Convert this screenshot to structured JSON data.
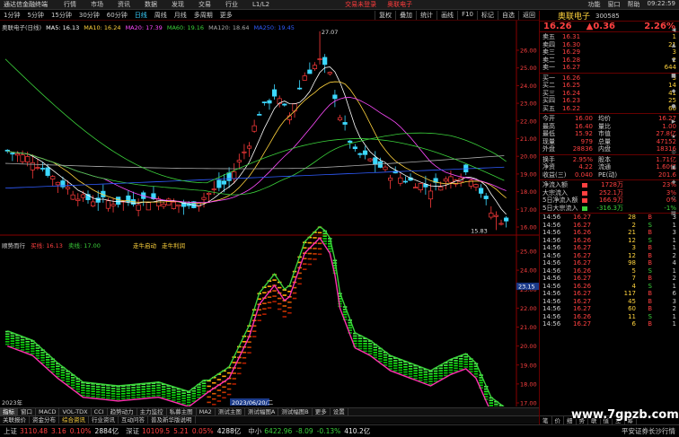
{
  "menu": {
    "logo": "通达信金融终端",
    "items": [
      "行情",
      "市场",
      "资讯",
      "数据",
      "发现",
      "交易",
      "行业",
      "L1/L2"
    ],
    "center": [
      "交易未登录",
      "奥联电子"
    ],
    "right": [
      "功能",
      "窗口",
      "帮助",
      "09:22:59"
    ]
  },
  "toolbar": {
    "periods": [
      "1分钟",
      "5分钟",
      "15分钟",
      "30分钟",
      "60分钟",
      "日线",
      "周线",
      "月线",
      "多周期",
      "更多"
    ],
    "active_index": 5,
    "right": [
      "复权",
      "叠加",
      "统计",
      "画线",
      "F10",
      "标记",
      "自选",
      "返回"
    ]
  },
  "indicator_header": {
    "title": "奥联电子(日线)",
    "ma": [
      {
        "label": "MA5: 16.13",
        "color": "#ffffff"
      },
      {
        "label": "MA10: 16.24",
        "color": "#ffd33d"
      },
      {
        "label": "MA20: 17.39",
        "color": "#ff4bff"
      },
      {
        "label": "MA60: 19.16",
        "color": "#3bd13b"
      },
      {
        "label": "MA120: 18.64",
        "color": "#aaaaaa"
      },
      {
        "label": "MA250: 19.45",
        "color": "#2f5cff"
      }
    ]
  },
  "sub_header": {
    "name": "顺势而行",
    "items": [
      {
        "label": "买线: 16.13",
        "color": "#ff4040"
      },
      {
        "label": "卖线: 17.00",
        "color": "#3bd13b"
      },
      {
        "label": "走牛启动",
        "color": "#ffd33d"
      },
      {
        "label": "走牛利润",
        "color": "#ffd33d"
      }
    ]
  },
  "chart_data": {
    "type": "candlestick",
    "main_axis": [
      "26.00",
      "25.00",
      "24.00",
      "23.00",
      "22.00",
      "21.00",
      "20.00",
      "19.00",
      "18.00",
      "17.00",
      "16.00"
    ],
    "sub_axis": [
      "25.00",
      "24.00",
      "23.00",
      "22.00",
      "21.00",
      "20.00",
      "19.00",
      "18.00",
      "17.00"
    ],
    "high_label": "27.07",
    "low_label": "15.83",
    "sub_price_tag": "23.15",
    "date_tags": [
      "2023年",
      "2023/06/20/二"
    ]
  },
  "tabs1": [
    "指标",
    "窗口",
    "MACD",
    "VOL-TDX",
    "CCI",
    "趋势动力",
    "主力监控",
    "私募主图",
    "MA2",
    "测试主图",
    "测试幅图A",
    "测试幅图B",
    "更多",
    "设置"
  ],
  "tabs1_active": 0,
  "tabs2": [
    "关联报价",
    "资金分布",
    "综合资讯",
    "行业资讯",
    "互动问答",
    "普及新华版说明"
  ],
  "tabs2_active": 2,
  "status": {
    "sh_label": "上证",
    "sh_val": "3110.48",
    "sh_chg": "3.16",
    "sh_pct": "0.10%",
    "sh_amt": "2884亿",
    "sz_label": "深证",
    "sz_val": "10109.5",
    "sz_chg": "5.21",
    "sz_pct": "0.05%",
    "sz_amt": "4288亿",
    "zx_label": "中小",
    "zx_val": "6422.96",
    "zx_chg": "-8.09",
    "zx_pct": "-0.13%",
    "zx_amt": "410.2亿",
    "right": "平安证券长沙行情"
  },
  "panel": {
    "name": "奥联电子",
    "code": "300585",
    "price": "16.26",
    "chg": "▲0.36",
    "pct": "2.26%",
    "asks": [
      {
        "label": "卖五",
        "price": "16.31",
        "vol": "1"
      },
      {
        "label": "卖四",
        "price": "16.30",
        "vol": "21"
      },
      {
        "label": "卖三",
        "price": "16.29",
        "vol": "3"
      },
      {
        "label": "卖二",
        "price": "16.28",
        "vol": "2"
      },
      {
        "label": "卖一",
        "price": "16.27",
        "vol": "644"
      }
    ],
    "bids": [
      {
        "label": "买一",
        "price": "16.26",
        "vol": "3"
      },
      {
        "label": "买二",
        "price": "16.25",
        "vol": "14"
      },
      {
        "label": "买三",
        "price": "16.24",
        "vol": "41"
      },
      {
        "label": "买四",
        "price": "16.23",
        "vol": "25"
      },
      {
        "label": "买五",
        "price": "16.22",
        "vol": "60"
      }
    ],
    "quote": [
      {
        "l1": "今开",
        "v1": "16.00",
        "l2": "均价",
        "v2": "16.27"
      },
      {
        "l1": "最高",
        "v1": "16.40",
        "l2": "量比",
        "v2": "1.00"
      },
      {
        "l1": "最低",
        "v1": "15.92",
        "l2": "市值",
        "v2": "27.8亿"
      },
      {
        "l1": "现量",
        "v1": "979",
        "l2": "总量",
        "v2": "47152"
      },
      {
        "l1": "外盘",
        "v1": "28836",
        "l2": "内盘",
        "v2": "18316"
      }
    ],
    "quote2": [
      {
        "l1": "换手",
        "v1": "2.95%",
        "l2": "股本",
        "v2": "1.71亿"
      },
      {
        "l1": "净资",
        "v1": "4.22",
        "l2": "流通",
        "v2": "1.60亿"
      },
      {
        "l1": "收益(三)",
        "v1": "0.040",
        "l2": "PE(动)",
        "v2": "201.6"
      }
    ],
    "flows": [
      {
        "label": "净流入额",
        "val": "1728万",
        "pct": "23%",
        "color": "#ff4040"
      },
      {
        "label": "大宗流入",
        "val": "252.1万",
        "pct": "3%",
        "color": "#ff4040"
      },
      {
        "label": "5日净流入额",
        "val": "166.9万",
        "pct": "0%",
        "color": "#ff4040"
      },
      {
        "label": "5日大宗流入",
        "val": "-316.3万",
        "pct": "-1%",
        "color": "#3bd13b"
      }
    ],
    "ticks": [
      {
        "t": "14:56",
        "p": "16.27",
        "v": "28",
        "bs": "B",
        "n": "3"
      },
      {
        "t": "14:56",
        "p": "16.27",
        "v": "2",
        "bs": "S",
        "n": "1"
      },
      {
        "t": "14:56",
        "p": "16.26",
        "v": "21",
        "bs": "B",
        "n": "3"
      },
      {
        "t": "14:56",
        "p": "16.26",
        "v": "12",
        "bs": "S",
        "n": "1"
      },
      {
        "t": "14:56",
        "p": "16.27",
        "v": "3",
        "bs": "B",
        "n": "1"
      },
      {
        "t": "14:56",
        "p": "16.27",
        "v": "12",
        "bs": "B",
        "n": "2"
      },
      {
        "t": "14:56",
        "p": "16.27",
        "v": "98",
        "bs": "B",
        "n": "4"
      },
      {
        "t": "14:56",
        "p": "16.26",
        "v": "5",
        "bs": "S",
        "n": "1"
      },
      {
        "t": "14:56",
        "p": "16.27",
        "v": "7",
        "bs": "B",
        "n": "2"
      },
      {
        "t": "14:56",
        "p": "16.26",
        "v": "4",
        "bs": "S",
        "n": "1"
      },
      {
        "t": "14:56",
        "p": "16.27",
        "v": "117",
        "bs": "B",
        "n": "6"
      },
      {
        "t": "14:56",
        "p": "16.27",
        "v": "45",
        "bs": "B",
        "n": "3"
      },
      {
        "t": "14:56",
        "p": "16.27",
        "v": "60",
        "bs": "B",
        "n": "2"
      },
      {
        "t": "14:56",
        "p": "16.26",
        "v": "11",
        "bs": "S",
        "n": "1"
      },
      {
        "t": "14:56",
        "p": "16.27",
        "v": "6",
        "bs": "B",
        "n": "1"
      }
    ],
    "foot": [
      "笔",
      "价",
      "细",
      "势",
      "联",
      "值",
      "主",
      "筹"
    ]
  },
  "sidebar": [
    "◀",
    "▲",
    "▼",
    "■",
    "◆",
    "●",
    "▶",
    "★",
    "◎",
    "▣",
    "✚",
    "◇",
    "▤"
  ],
  "watermark": "www.7gpzb.com"
}
